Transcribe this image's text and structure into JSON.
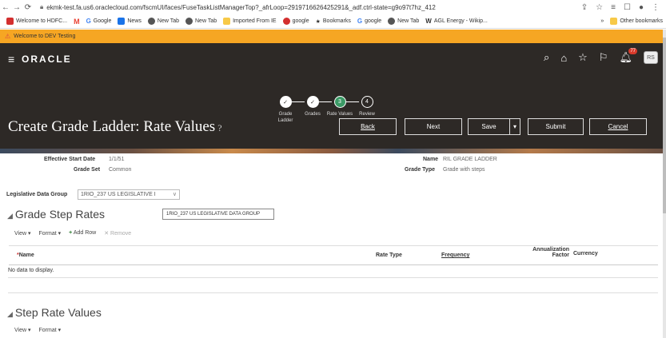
{
  "browser": {
    "url": "ekmk-test.fa.us6.oraclecloud.com/fscmUI/faces/FuseTaskListManagerTop?_afrLoop=2919716626425291&_adf.ctrl-state=g9o97t7hz_412",
    "bookmarks": [
      {
        "label": "Welcome to HDFC...",
        "color": "#d32f2f"
      },
      {
        "label": "",
        "color": "#ea4335",
        "mark": "M"
      },
      {
        "label": "Google",
        "color": "#4285f4",
        "mark": "G"
      },
      {
        "label": "News",
        "color": "#1a73e8"
      },
      {
        "label": "New Tab",
        "color": "#555"
      },
      {
        "label": "New Tab",
        "color": "#555"
      },
      {
        "label": "Imported From IE",
        "color": "#f7c948"
      },
      {
        "label": "google",
        "color": "#d32f2f"
      },
      {
        "label": "Bookmarks",
        "color": "#555"
      },
      {
        "label": "google",
        "color": "#4285f4"
      },
      {
        "label": "New Tab",
        "color": "#555"
      },
      {
        "label": "AGL Energy - Wikip...",
        "color": "#333",
        "mark": "W"
      }
    ],
    "other_bookmarks": "Other bookmarks"
  },
  "banner": {
    "text": "Welcome to DEV Testing"
  },
  "header": {
    "logo": "ORACLE",
    "notification_count": "77",
    "avatar": "RS"
  },
  "train": {
    "steps": [
      {
        "label": "Grade Ladder",
        "state": "done",
        "mark": "✓"
      },
      {
        "label": "Grades",
        "state": "done",
        "mark": "✓"
      },
      {
        "label": "Rate Values",
        "state": "current",
        "mark": "3"
      },
      {
        "label": "Review",
        "state": "next",
        "mark": "4"
      }
    ]
  },
  "page": {
    "title": "Create Grade Ladder: Rate Values",
    "buttons": {
      "back": "Back",
      "next": "Next",
      "save": "Save",
      "submit": "Submit",
      "cancel": "Cancel"
    }
  },
  "details": {
    "effective_start_date_label": "Effective Start Date",
    "effective_start_date": "1/1/51",
    "grade_set_label": "Grade Set",
    "grade_set": "Common",
    "name_label": "Name",
    "name": "RIL GRADE LADDER",
    "grade_type_label": "Grade Type",
    "grade_type": "Grade with steps"
  },
  "ldg": {
    "label": "Legislative Data Group",
    "value": "1RIO_237 US LEGISLATIVE I",
    "tooltip": "1RIO_237 US LEGISLATIVE DATA GROUP"
  },
  "grade_step_rates": {
    "heading": "Grade Step Rates",
    "toolbar": {
      "view": "View ▾",
      "format": "Format ▾",
      "add": "Add Row",
      "remove": "Remove"
    },
    "columns": {
      "name": "Name",
      "rate_type": "Rate Type",
      "frequency": "Frequency",
      "annualization_1": "Annualization",
      "annualization_2": "Factor",
      "currency": "Currency"
    },
    "empty": "No data to display."
  },
  "step_rate_values": {
    "heading": "Step Rate Values",
    "toolbar": {
      "view": "View ▾",
      "format": "Format ▾"
    }
  }
}
